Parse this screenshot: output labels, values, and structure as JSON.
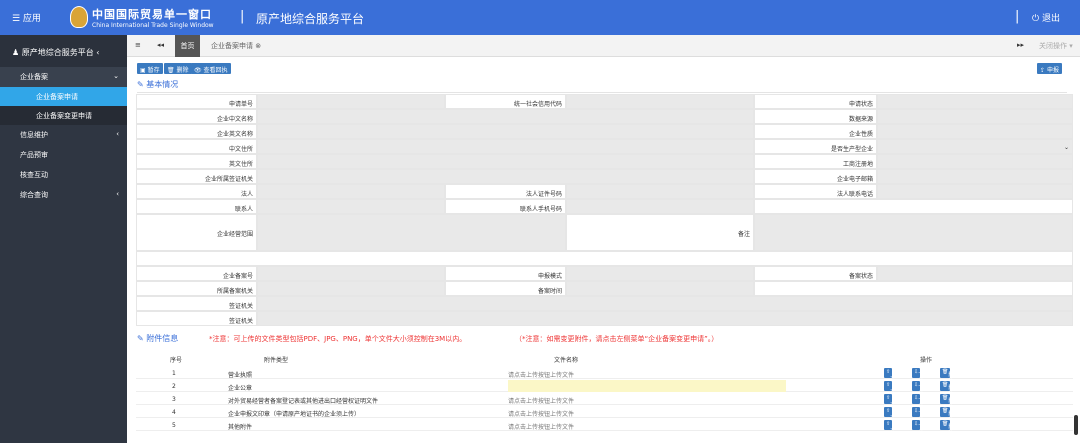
{
  "topbar": {
    "menu_label": "☰  应用",
    "brand": "中国国际贸易单一窗口",
    "brand_en": "China International Trade Single Window",
    "separator": "|",
    "platform": "原产地综合服务平台",
    "logout": "⏻  退出"
  },
  "sidebar": {
    "header": "原产地综合服务平台",
    "items": [
      {
        "label": "企业备案",
        "arrow": "⌄"
      },
      {
        "label": "企业备案申请"
      },
      {
        "label": "企业备案变更申请"
      },
      {
        "label": "信息维护",
        "arrow": "‹"
      },
      {
        "label": "产品预审"
      },
      {
        "label": "核查互动"
      },
      {
        "label": "综合查询",
        "arrow": "‹"
      }
    ]
  },
  "tabs": {
    "menu": "≡",
    "back": "◂◂",
    "home": "首页",
    "current": "企业备案申请 ⊗",
    "forward": "▸▸",
    "close_ops": "关闭操作 ▾"
  },
  "toolbar": {
    "save": "暂存",
    "delete": "删除",
    "view_receipt": "查看回执",
    "submit": "申报"
  },
  "basic_info": {
    "title": "基本情况"
  },
  "fields": {
    "apply_no": "申请单号",
    "credit_code": "统一社会信用代码",
    "apply_status": "申请状态",
    "name_cn": "企业中文名称",
    "data_source": "数据来源",
    "name_en": "企业英文名称",
    "enterprise_nature": "企业性质",
    "addr_cn": "中文住所",
    "is_producer": "是否生产型企业",
    "addr_en": "英文住所",
    "reg_place": "工商注册地",
    "agency": "企业所属签证机关",
    "email": "企业电子邮箱",
    "legal_person": "法人",
    "legal_id": "法人证件号码",
    "legal_phone": "法人联系电话",
    "contact": "联系人",
    "contact_phone": "联系人手机号码",
    "scope": "企业经营范围",
    "remark": "备注",
    "record_no": "企业备案号",
    "apply_mode": "申报模式",
    "record_status": "备案状态",
    "record_agency": "所属备案机关",
    "record_time": "备案时间",
    "visa_list": "签证机关",
    "visa_agency": "签证机关"
  },
  "attachments": {
    "title": "附件信息",
    "note1": "*注意：可上传的文件类型包括PDF、JPG、PNG，单个文件大小须控制在3M以内。",
    "note2": "（*注意：如需变更附件，请点击左侧菜单“企业备案变更申请”。）",
    "headers": {
      "no": "序号",
      "type": "附件类型",
      "file": "文件名称",
      "ops": "操作"
    },
    "rows": [
      {
        "no": "1",
        "type": "营业执照",
        "file": "请点击上传按钮上传文件"
      },
      {
        "no": "2",
        "type": "企业公章",
        "file": ""
      },
      {
        "no": "3",
        "type": "对外贸易经营者备案登记表或其他进出口经营权证明文件",
        "file": "请点击上传按钮上传文件"
      },
      {
        "no": "4",
        "type": "企业申报文印章（申请原产地证书的企业须上传）",
        "file": "请点击上传按钮上传文件"
      },
      {
        "no": "5",
        "type": "其他附件",
        "file": "请点击上传按钮上传文件"
      }
    ],
    "op_upload": "上传",
    "op_download": "下载",
    "op_delete": "删除"
  }
}
